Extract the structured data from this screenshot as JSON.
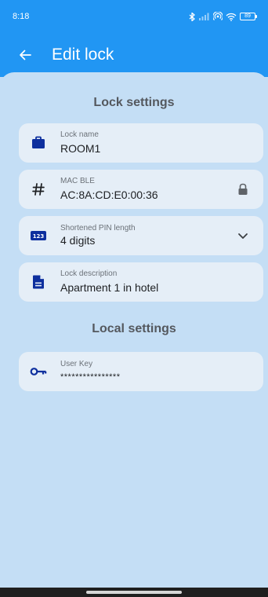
{
  "status_bar": {
    "time": "8:18",
    "battery_level": "89"
  },
  "app_bar": {
    "title": "Edit lock",
    "back_icon": "arrow-left-icon",
    "background_color": "#2196f3"
  },
  "sections": {
    "lock_settings_title": "Lock settings",
    "local_settings_title": "Local settings"
  },
  "fields": {
    "lock_name": {
      "label": "Lock name",
      "value": "ROOM1",
      "icon": "briefcase-icon"
    },
    "mac_ble": {
      "label": "MAC BLE",
      "value": "AC:8A:CD:E0:00:36",
      "icon": "hash-icon",
      "trailing_icon": "lock-icon"
    },
    "pin_length": {
      "label": "Shortened PIN length",
      "value": "4 digits",
      "icon": "numeric-123-icon",
      "trailing_icon": "chevron-down-icon",
      "icon_text": "123"
    },
    "lock_description": {
      "label": "Lock description",
      "value": "Apartment 1 in hotel",
      "icon": "document-icon"
    },
    "user_key": {
      "label": "User Key",
      "value": "****************",
      "icon": "key-icon"
    }
  },
  "colors": {
    "icon_navy": "#0d2f9e",
    "page_background": "#c4def5",
    "card_background": "#e5eef7"
  }
}
